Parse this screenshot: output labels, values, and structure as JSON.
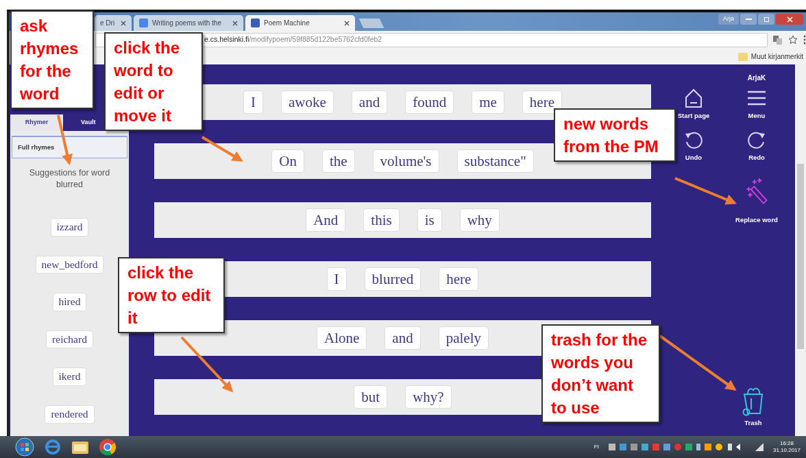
{
  "browser": {
    "tabs": [
      {
        "title": "e Dri",
        "selected": false
      },
      {
        "title": "Writing poems with the",
        "selected": false
      },
      {
        "title": "Poem Machine",
        "selected": true
      }
    ],
    "user": "Arja",
    "url_host": "e.cs.helsinki.fi",
    "url_path": "/modifypoem/59f885d122be5762cfd0feb2",
    "bookmarks_folder": "Muut kirjanmerkit"
  },
  "sidebar": {
    "tabs": [
      {
        "label": "Rhymer",
        "selected": true
      },
      {
        "label": "Vault",
        "selected": false
      }
    ],
    "mode": "Full rhymes",
    "caption": "Suggestions for word blurred",
    "suggestions": [
      "izzard",
      "new_bedford",
      "hired",
      "reichard",
      "ikerd",
      "rendered"
    ]
  },
  "poem": {
    "rows": [
      {
        "words": [
          "I",
          "awoke",
          "and",
          "found",
          "me",
          "here"
        ]
      },
      {
        "words": [
          "On",
          "the",
          "volume's",
          "substance\""
        ]
      },
      {
        "words": [
          "And",
          "this",
          "is",
          "why"
        ]
      },
      {
        "words": [
          "I",
          "blurred",
          "here"
        ]
      },
      {
        "words": [
          "Alone",
          "and",
          "palely"
        ]
      },
      {
        "words": [
          "but",
          "why?"
        ]
      }
    ]
  },
  "toolbar": {
    "user": "ArjaK",
    "buttons": [
      {
        "kind": "home",
        "label": "Start page"
      },
      {
        "kind": "menu",
        "label": "Menu"
      },
      {
        "kind": "undo",
        "label": "Undo"
      },
      {
        "kind": "redo",
        "label": "Redo"
      },
      {
        "kind": "wand",
        "label": "Replace word"
      }
    ],
    "trash": "Trash"
  },
  "callouts": [
    {
      "text": "ask rhymes for the word"
    },
    {
      "text": "click the word to edit or move it"
    },
    {
      "text": "new words from the PM"
    },
    {
      "text": "click the row to edit it"
    },
    {
      "text": "trash for the words you don’t want to use"
    }
  ],
  "taskbar": {
    "language": "FI",
    "time": "16:28",
    "date": "31.10.2017"
  }
}
